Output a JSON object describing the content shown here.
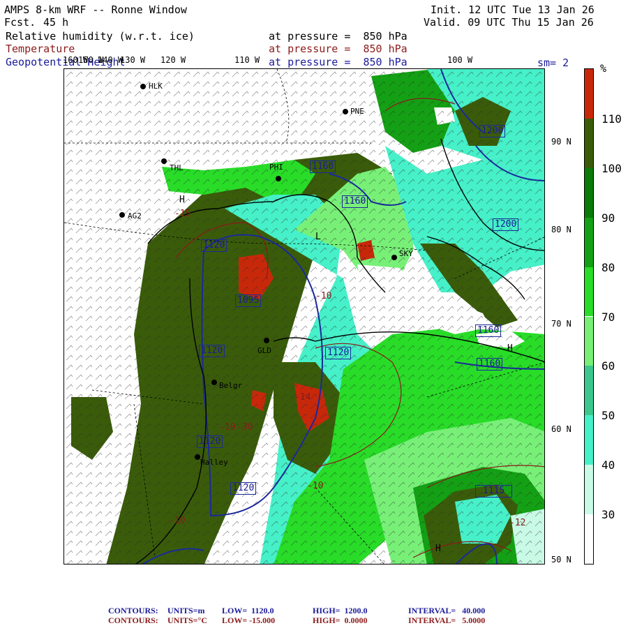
{
  "header": {
    "title": "AMPS 8-km WRF -- Ronne Window",
    "fcst_label": "Fcst.",
    "fcst_value": "45 h",
    "init": "Init. 12 UTC Tue 13 Jan 26",
    "valid": "Valid. 09 UTC Thu 15 Jan 26"
  },
  "fields": [
    {
      "name": "Relative humidity (w.r.t. ice)",
      "level": "at pressure =  850 hPa",
      "color": "#000000"
    },
    {
      "name": "Temperature",
      "level": "at pressure =  850 hPa",
      "color": "#8b1a1a"
    },
    {
      "name": "Geopotential Height",
      "level": "at pressure =  850 hPa",
      "color": "#1a1a9a"
    }
  ],
  "smoothing": "sm= 2",
  "lon_labels": [
    "160 W",
    "150 W",
    "140 W",
    "130 W",
    "120 W",
    "110 W",
    "100 W"
  ],
  "lat_labels": [
    "90 N",
    "80 N",
    "70 N",
    "60 N",
    "50 N"
  ],
  "stations": [
    "HLK",
    "PNE",
    "THL",
    "PHI",
    "AG2",
    "SKY",
    "GLD",
    "Belgr",
    "Halley"
  ],
  "height_labels": [
    "1160",
    "1160",
    "1200",
    "1200",
    "1120",
    "1095",
    "1120",
    "1120",
    "1120",
    "1120",
    "1160",
    "1160",
    "1115"
  ],
  "temp_labels": [
    "-10",
    "-10",
    "-14",
    "-15",
    "-10",
    "-10",
    "-30",
    "-12"
  ],
  "pressure_markers": [
    "L",
    "H",
    "H",
    "H"
  ],
  "colorbar": {
    "unit": "%",
    "labels": [
      "110",
      "100",
      "90",
      "80",
      "70",
      "60",
      "50",
      "40",
      "30"
    ],
    "colors": [
      "#c8280a",
      "#3a5c0a",
      "#0a7a0a",
      "#14a014",
      "#28dc28",
      "#78f078",
      "#3cc88c",
      "#46f0c8",
      "#c8fae6",
      "#ffffff"
    ]
  },
  "footer": [
    {
      "label": "CONTOURS:",
      "units": "UNITS=m",
      "low": "LOW=  1120.0",
      "high": "HIGH=  1200.0",
      "interval": "INTERVAL=   40.000",
      "color": "#1a1a9a"
    },
    {
      "label": "CONTOURS:",
      "units": "UNITS=°C",
      "low": "LOW= -15.000",
      "high": "HIGH=  0.0000",
      "interval": "INTERVAL=   5.0000",
      "color": "#8b1a1a"
    }
  ]
}
